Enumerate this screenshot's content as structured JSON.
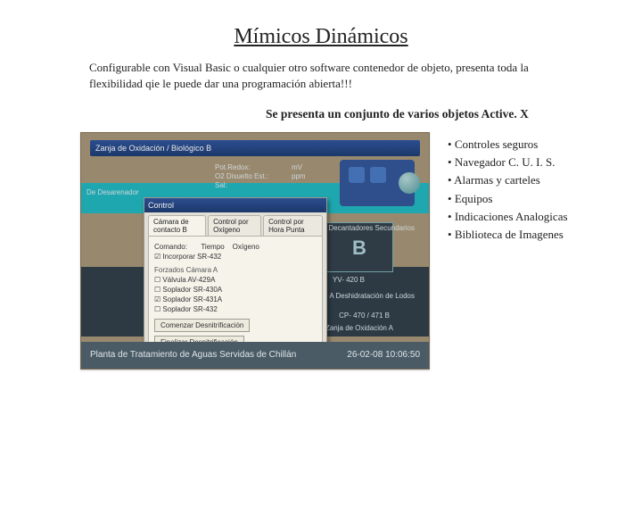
{
  "title": "Mímicos Dinámicos",
  "description": "Configurable con Visual Basic o cualquier otro software contenedor de objeto, presenta toda la flexibilidad qie le puede dar una programación abierta!!!",
  "subtitle": "Se presenta un conjunto de varios objetos Active. X",
  "bullets": [
    "Controles seguros",
    "Navegador C. U. I. S.",
    "Alarmas y carteles",
    "Equipos",
    "Indicaciones Analogicas",
    "Biblioteca de Imagenes"
  ],
  "fig": {
    "windowTitle": "Zanja de Oxidación / Biológico B",
    "dialog": {
      "title": "Control",
      "tabs": [
        "Cámara de contacto B",
        "Control por Oxígeno",
        "Control por Hora  Punta"
      ],
      "tabsActive": "Cámara de contacto B",
      "cmdLabel": "Comando:",
      "fields": [
        "Tiempo",
        "Oxígeno"
      ],
      "chkSr432": "Incorporar SR-432",
      "group": "Forzados Cámara A",
      "items": [
        {
          "checked": false,
          "label": "Válvula AV-429A"
        },
        {
          "checked": false,
          "label": "Soplador SR-430A"
        },
        {
          "checked": true,
          "label": "Soplador SR-431A"
        },
        {
          "checked": false,
          "label": "Soplador SR-432"
        }
      ],
      "btn1": "Comenzar Desnitrificación",
      "btn2": "Finalizar Desnitrificación"
    },
    "tank": "B",
    "labels": {
      "deDesarenador": "De Desarenador",
      "potRedox": "Pot.Redox:",
      "o2": "O2 Disuelto Est.:",
      "sal": "Sal:",
      "mv": "mV",
      "ppm": "ppm",
      "aDecant": "A Decantadores Secundarios",
      "aDesh": "A Deshidratación de Lodos",
      "yv": "YV- 420 B",
      "cp": "CP- 470 / 471 B",
      "zanja": "Zanja de Oxidación A"
    },
    "footer": {
      "left": "Planta de Tratamiento de Aguas Servidas de Chillán",
      "right": "26-02-08   10:06:50"
    }
  }
}
